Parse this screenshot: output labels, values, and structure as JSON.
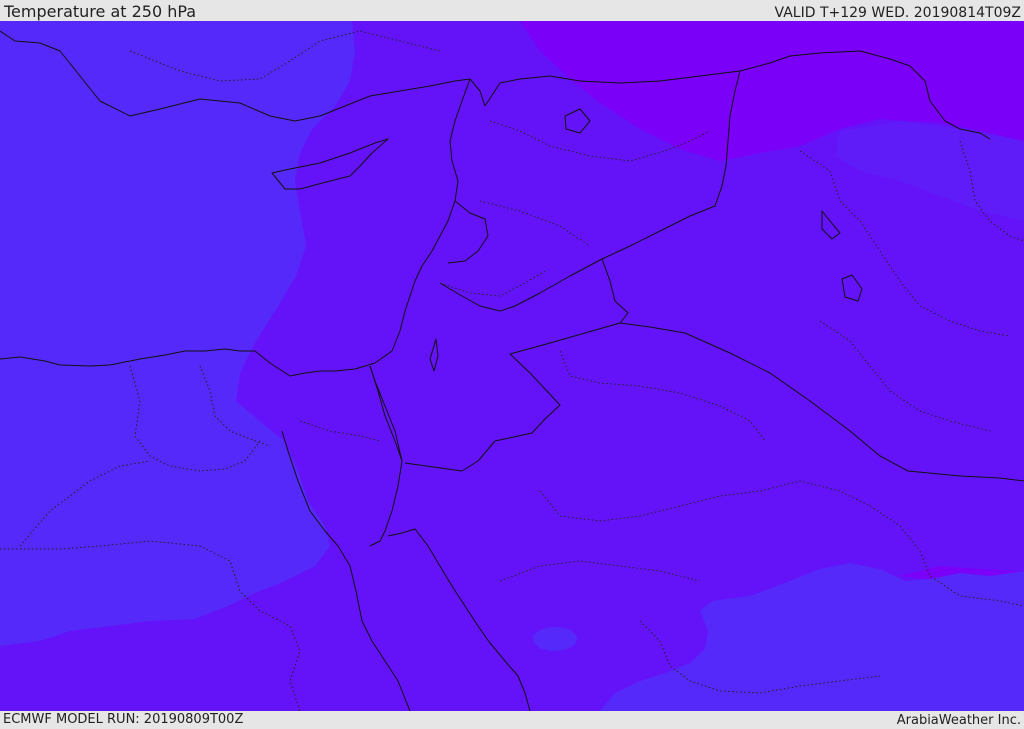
{
  "header": {
    "title": "Temperature at 250 hPa",
    "valid_time": "VALID T+129 WED. 20190814T09Z"
  },
  "footer": {
    "model_run": "ECMWF MODEL RUN: 20190809T00Z",
    "credit": "ArabiaWeather Inc."
  },
  "colors": {
    "background": "#e6e6e6",
    "band_cool": "#5529f9",
    "band_mid": "#6413f9",
    "band_warm": "#7a00f8",
    "coastline": "#111111"
  }
}
